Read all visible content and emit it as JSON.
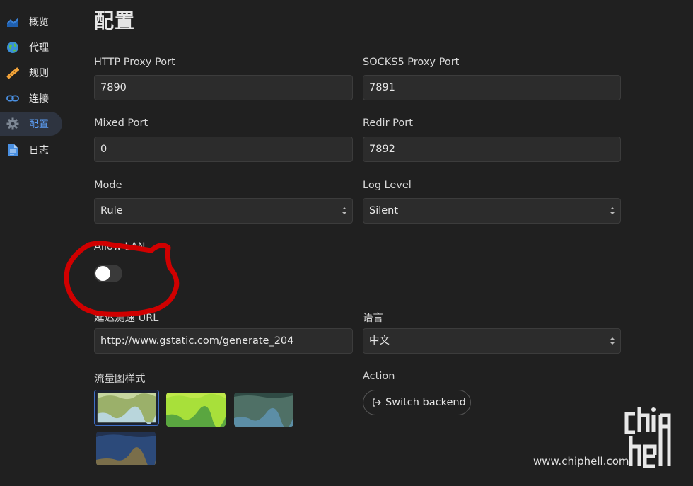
{
  "sidebar": {
    "items": [
      {
        "label": "概览",
        "icon": "chart-icon"
      },
      {
        "label": "代理",
        "icon": "globe-icon"
      },
      {
        "label": "规则",
        "icon": "ruler-icon"
      },
      {
        "label": "连接",
        "icon": "link-icon"
      },
      {
        "label": "配置",
        "icon": "gear-icon",
        "active": true
      },
      {
        "label": "日志",
        "icon": "document-icon"
      }
    ]
  },
  "page": {
    "title": "配置"
  },
  "fields": {
    "http_port": {
      "label": "HTTP Proxy Port",
      "value": "7890"
    },
    "socks5_port": {
      "label": "SOCKS5 Proxy Port",
      "value": "7891"
    },
    "mixed_port": {
      "label": "Mixed Port",
      "value": "0"
    },
    "redir_port": {
      "label": "Redir Port",
      "value": "7892"
    },
    "mode": {
      "label": "Mode",
      "value": "Rule"
    },
    "log_level": {
      "label": "Log Level",
      "value": "Silent"
    },
    "allow_lan": {
      "label": "Allow LAN",
      "enabled": false
    },
    "latency_url": {
      "label": "延迟测速 URL",
      "value": "http://www.gstatic.com/generate_204"
    },
    "language": {
      "label": "语言",
      "value": "中文"
    },
    "traffic_style": {
      "label": "流量图样式",
      "selected": 0
    },
    "action": {
      "label": "Action",
      "button": "Switch backend"
    }
  },
  "colors": {
    "background": "#202020",
    "accent": "#5b9bf0",
    "annotation": "#d00000"
  },
  "watermark": {
    "text": "www.chiphell.com",
    "logo": "chip hell"
  }
}
